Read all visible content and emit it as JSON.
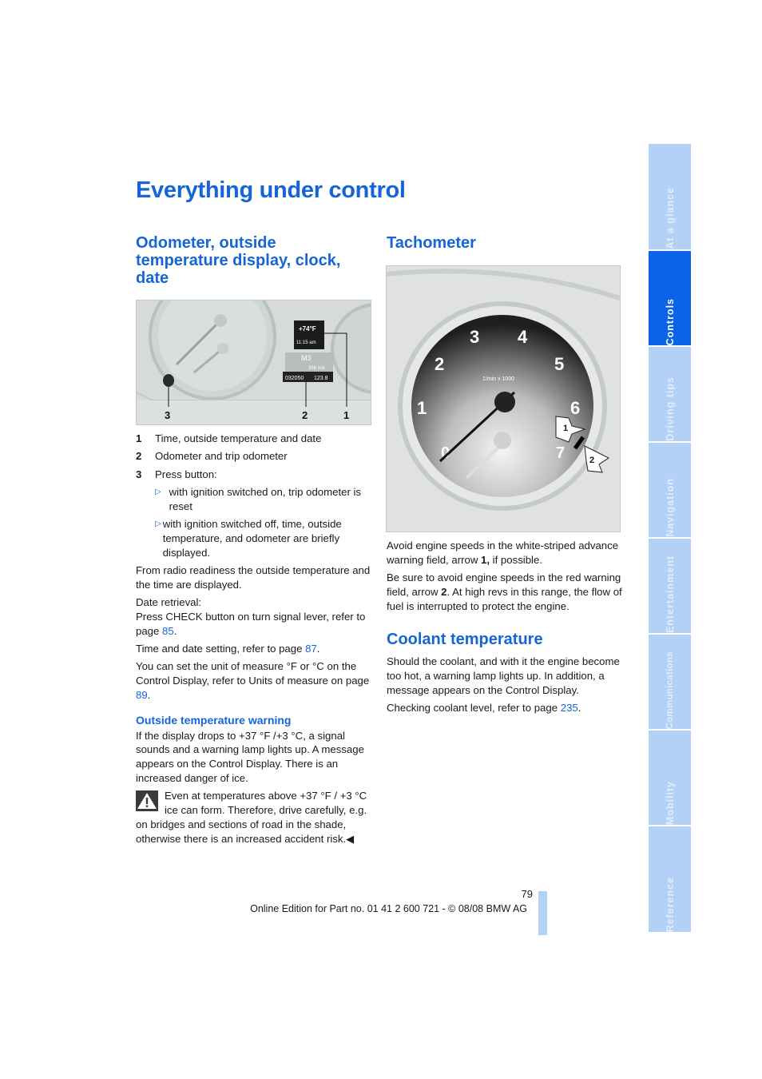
{
  "page_title": "Everything under control",
  "left": {
    "heading": "Odometer, outside temperature display, clock, date",
    "figure": {
      "display_temp": "+74°F",
      "display_time": "11:15 am",
      "display_model": "M3",
      "display_range": "358 mls",
      "odometer": "032050",
      "trip": "123.8",
      "callouts": [
        "3",
        "2",
        "1"
      ]
    },
    "items": [
      {
        "num": "1",
        "text": "Time, outside temperature and date"
      },
      {
        "num": "2",
        "text": "Odometer and trip odometer"
      },
      {
        "num": "3",
        "text": "Press button:"
      }
    ],
    "sub_items": [
      "with ignition switched on, trip odometer is reset",
      "with ignition switched off, time, outside temperature, and odometer are briefly displayed."
    ],
    "para1": "From radio readiness the outside temperature and the time are displayed.",
    "date_retrieval_label": "Date retrieval:",
    "date_retrieval_text": "Press CHECK button on turn signal lever, refer to page ",
    "date_retrieval_page": "85",
    "time_setting_text": "Time and date setting, refer to page ",
    "time_setting_page": "87",
    "units_text": "You can set the unit of measure °F or °C on the Control Display, refer to Units of measure on page ",
    "units_page": "89",
    "warning_heading": "Outside temperature warning",
    "warning_para": "If the display drops to +37 °F /+3 °C, a signal sounds and a warning lamp lights up. A message appears on the Control Display. There is an increased danger of ice.",
    "caution_text": "Even at temperatures above +37 °F / +3 °C ice can form. Therefore, drive carefully, e.g. on bridges and sections of road in the shade, otherwise there is an increased accident risk.",
    "end_mark": "◀"
  },
  "right": {
    "tach_heading": "Tachometer",
    "tach_figure": {
      "scale_label": "1/min x 1000",
      "numbers": [
        "0",
        "1",
        "2",
        "3",
        "4",
        "5",
        "6",
        "7"
      ],
      "callouts": [
        "1",
        "2"
      ]
    },
    "tach_para1_a": "Avoid engine speeds in the white-striped advance warning field, arrow ",
    "tach_para1_b": "1,",
    "tach_para1_c": " if possible.",
    "tach_para2_a": "Be sure to avoid engine speeds in the red warning field, arrow ",
    "tach_para2_b": "2",
    "tach_para2_c": ". At high revs in this range, the flow of fuel is interrupted to protect the engine.",
    "coolant_heading": "Coolant temperature",
    "coolant_para1": "Should the coolant, and with it the engine become too hot, a warning lamp lights up. In addition, a message appears on the Control Display.",
    "coolant_para2": "Checking coolant level, refer to page ",
    "coolant_page": "235"
  },
  "side_tabs": [
    {
      "label": "At a glance",
      "active": false
    },
    {
      "label": "Controls",
      "active": true
    },
    {
      "label": "Driving tips",
      "active": false
    },
    {
      "label": "Navigation",
      "active": false
    },
    {
      "label": "Entertainment",
      "active": false
    },
    {
      "label": "Communications",
      "active": false
    },
    {
      "label": "Mobility",
      "active": false
    },
    {
      "label": "Reference",
      "active": false
    }
  ],
  "footer": {
    "page_number": "79",
    "edition": "Online Edition for Part no. 01 41 2 600 721 - © 08/08 BMW AG"
  }
}
